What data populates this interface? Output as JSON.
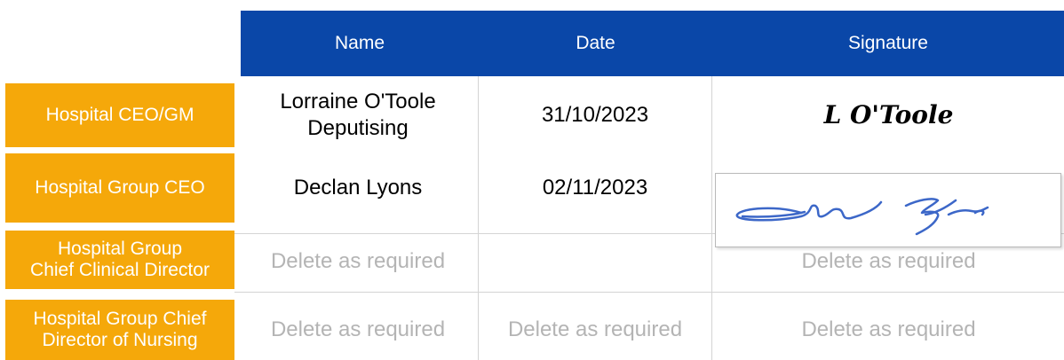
{
  "header": {
    "name": "Name",
    "date": "Date",
    "signature": "Signature"
  },
  "rows": [
    {
      "label": "Hospital CEO/GM",
      "name_line1": "Lorraine O'Toole",
      "name_line2": "Deputising",
      "date": "31/10/2023",
      "signature": "L O'Toole"
    },
    {
      "label": "Hospital Group CEO",
      "name": "Declan Lyons",
      "date": "02/11/2023"
    },
    {
      "label_line1": "Hospital Group",
      "label_line2": "Chief Clinical Director",
      "name": "Delete as required",
      "date": "",
      "signature": "Delete as required"
    },
    {
      "label_line1": "Hospital Group Chief",
      "label_line2": "Director of Nursing",
      "name": "Delete as required",
      "date": "Delete as required",
      "signature": "Delete as required"
    }
  ],
  "colors": {
    "header_bg": "#0a47a8",
    "row_label_bg": "#f5a80a",
    "placeholder_text": "#b4b4b4",
    "signature_ink": "#3c67c8"
  }
}
